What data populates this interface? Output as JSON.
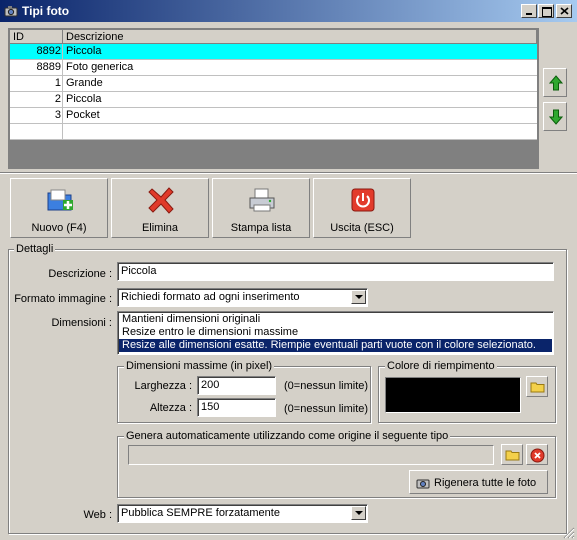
{
  "window": {
    "title": "Tipi foto"
  },
  "grid": {
    "columns": [
      "ID",
      "Descrizione"
    ],
    "rows": [
      {
        "id": "8892",
        "desc": "Piccola",
        "selected": true
      },
      {
        "id": "8889",
        "desc": "Foto generica"
      },
      {
        "id": "1",
        "desc": "Grande"
      },
      {
        "id": "2",
        "desc": "Piccola"
      },
      {
        "id": "3",
        "desc": "Pocket"
      },
      {
        "id": "",
        "desc": ""
      }
    ]
  },
  "toolbar": {
    "new_label": "Nuovo (F4)",
    "delete_label": "Elimina",
    "print_label": "Stampa lista",
    "exit_label": "Uscita (ESC)"
  },
  "details": {
    "legend": "Dettagli",
    "descrizione_label": "Descrizione :",
    "descrizione_value": "Piccola",
    "formato_label": "Formato immagine :",
    "formato_value": "Richiedi formato ad ogni inserimento",
    "dimensioni_label": "Dimensioni :",
    "dimensioni_options": [
      "Mantieni dimensioni originali",
      "Resize entro le dimensioni massime",
      "Resize alle dimensioni esatte. Riempie eventuali parti vuote con il colore selezionato."
    ],
    "dimensioni_selected": 2,
    "max_legend": "Dimensioni massime (in pixel)",
    "larghezza_label": "Larghezza :",
    "larghezza_value": "200",
    "altezza_label": "Altezza :",
    "altezza_value": "150",
    "nolimit_hint": "(0=nessun limite)",
    "color_legend": "Colore di riempimento",
    "fill_color": "#000000",
    "auto_legend": "Genera automaticamente utilizzando come origine il seguente tipo",
    "auto_value": "",
    "regen_label": "Rigenera tutte le foto",
    "web_label": "Web :",
    "web_value": "Pubblica SEMPRE forzatamente"
  },
  "colors": {
    "title_start": "#0a246a",
    "title_end": "#a6caf0",
    "selected_row": "#00ffff",
    "list_selection": "#0a246a"
  }
}
